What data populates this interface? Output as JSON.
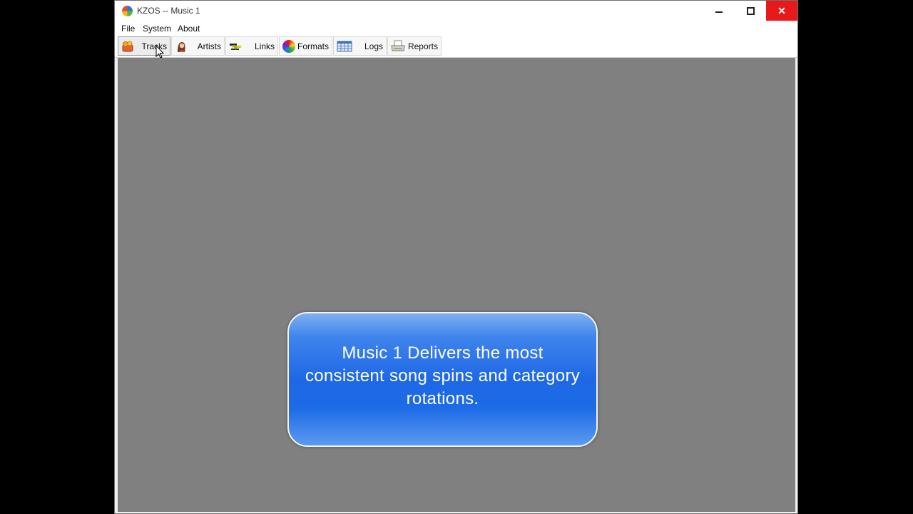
{
  "window": {
    "title": "KZOS -- Music 1",
    "close_glyph": "✕"
  },
  "menu": {
    "file": "File",
    "system": "System",
    "about": "About"
  },
  "toolbar": {
    "tracks": {
      "label": "Tracks",
      "icon": "tracks-icon"
    },
    "artists": {
      "label": "Artists",
      "icon": "artist-icon"
    },
    "links": {
      "label": "Links",
      "icon": "links-icon"
    },
    "formats": {
      "label": "Formats",
      "icon": "formats-icon"
    },
    "logs": {
      "label": "Logs",
      "icon": "logs-icon"
    },
    "reports": {
      "label": "Reports",
      "icon": "reports-icon"
    }
  },
  "callout": {
    "text": "Music 1 Delivers the most consistent song spins and category rotations."
  },
  "colors": {
    "workspace": "#808080",
    "callout_blue": "#1e68e6",
    "close_red": "#e8191b"
  }
}
